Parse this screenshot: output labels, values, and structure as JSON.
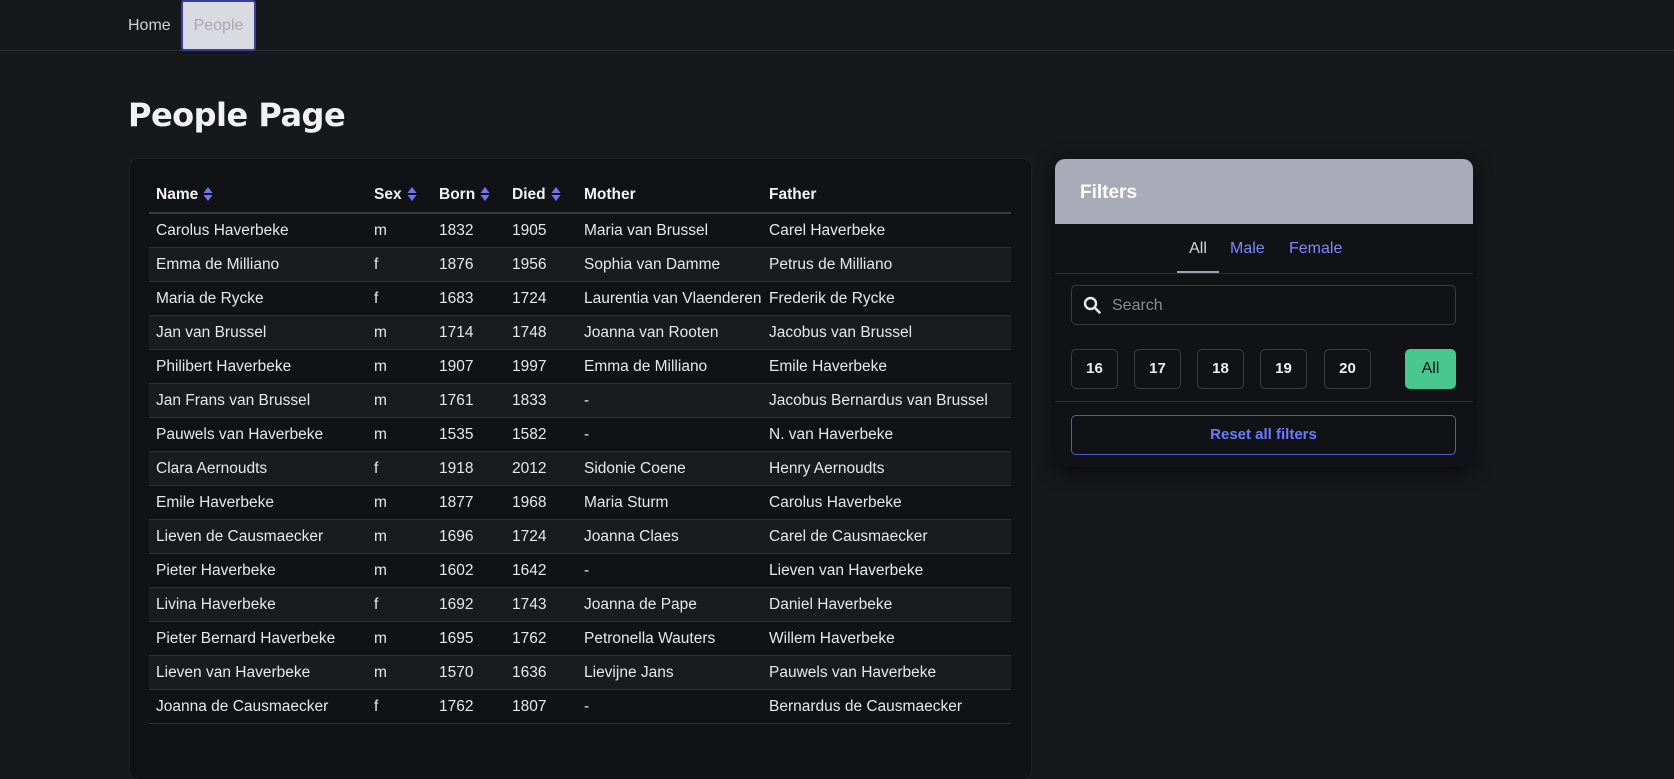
{
  "nav": {
    "home_label": "Home",
    "people_label": "People"
  },
  "page": {
    "title": "People Page"
  },
  "table": {
    "headers": {
      "name": "Name",
      "sex": "Sex",
      "born": "Born",
      "died": "Died",
      "mother": "Mother",
      "father": "Father"
    },
    "rows": [
      {
        "name": "Carolus Haverbeke",
        "name_sex": "m",
        "sex": "m",
        "born": "1832",
        "died": "1905",
        "mother": "Maria van Brussel",
        "mother_link": true,
        "father": "Carel Haverbeke",
        "father_link": true
      },
      {
        "name": "Emma de Milliano",
        "name_sex": "f",
        "sex": "f",
        "born": "1876",
        "died": "1956",
        "mother": "Sophia van Damme",
        "mother_link": false,
        "father": "Petrus de Milliano",
        "father_link": false
      },
      {
        "name": "Maria de Rycke",
        "name_sex": "f",
        "sex": "f",
        "born": "1683",
        "died": "1724",
        "mother": "Laurentia van Vlaenderen",
        "mother_link": false,
        "father": "Frederik de Rycke",
        "father_link": false
      },
      {
        "name": "Jan van Brussel",
        "name_sex": "m",
        "sex": "m",
        "born": "1714",
        "died": "1748",
        "mother": "Joanna van Rooten",
        "mother_link": false,
        "father": "Jacobus van Brussel",
        "father_link": false
      },
      {
        "name": "Philibert Haverbeke",
        "name_sex": "m",
        "sex": "m",
        "born": "1907",
        "died": "1997",
        "mother": "Emma de Milliano",
        "mother_link": true,
        "father": "Emile Haverbeke",
        "father_link": true
      },
      {
        "name": "Jan Frans van Brussel",
        "name_sex": "m",
        "sex": "m",
        "born": "1761",
        "died": "1833",
        "mother": "-",
        "mother_link": false,
        "father": "Jacobus Bernardus van Brussel",
        "father_link": true
      },
      {
        "name": "Pauwels van Haverbeke",
        "name_sex": "m",
        "sex": "m",
        "born": "1535",
        "died": "1582",
        "mother": "-",
        "mother_link": false,
        "father": "N. van Haverbeke",
        "father_link": false
      },
      {
        "name": "Clara Aernoudts",
        "name_sex": "f",
        "sex": "f",
        "born": "1918",
        "died": "2012",
        "mother": "Sidonie Coene",
        "mother_link": false,
        "father": "Henry Aernoudts",
        "father_link": false
      },
      {
        "name": "Emile Haverbeke",
        "name_sex": "m",
        "sex": "m",
        "born": "1877",
        "died": "1968",
        "mother": "Maria Sturm",
        "mother_link": true,
        "father": "Carolus Haverbeke",
        "father_link": true
      },
      {
        "name": "Lieven de Causmaecker",
        "name_sex": "m",
        "sex": "m",
        "born": "1696",
        "died": "1724",
        "mother": "Joanna Claes",
        "mother_link": false,
        "father": "Carel de Causmaecker",
        "father_link": false
      },
      {
        "name": "Pieter Haverbeke",
        "name_sex": "m",
        "sex": "m",
        "born": "1602",
        "died": "1642",
        "mother": "-",
        "mother_link": false,
        "father": "Lieven van Haverbeke",
        "father_link": true
      },
      {
        "name": "Livina Haverbeke",
        "name_sex": "f",
        "sex": "f",
        "born": "1692",
        "died": "1743",
        "mother": "Joanna de Pape",
        "mother_link": true,
        "father": "Daniel Haverbeke",
        "father_link": true
      },
      {
        "name": "Pieter Bernard Haverbeke",
        "name_sex": "m",
        "sex": "m",
        "born": "1695",
        "died": "1762",
        "mother": "Petronella Wauters",
        "mother_link": false,
        "father": "Willem Haverbeke",
        "father_link": true
      },
      {
        "name": "Lieven van Haverbeke",
        "name_sex": "m",
        "sex": "m",
        "born": "1570",
        "died": "1636",
        "mother": "Lievijne Jans",
        "mother_link": true,
        "father": "Pauwels van Haverbeke",
        "father_link": true
      },
      {
        "name": "Joanna de Causmaecker",
        "name_sex": "f",
        "sex": "f",
        "born": "1762",
        "died": "1807",
        "mother": "-",
        "mother_link": false,
        "father": "Bernardus de Causmaecker",
        "father_link": true
      }
    ]
  },
  "filters": {
    "title": "Filters",
    "tabs": {
      "all": "All",
      "male": "Male",
      "female": "Female"
    },
    "search_placeholder": "Search",
    "centuries": [
      "16",
      "17",
      "18",
      "19",
      "20"
    ],
    "century_all": "All",
    "reset_label": "Reset all filters"
  },
  "colors": {
    "male_link": "#7b87ff",
    "female_link": "#ff5c7a",
    "accent_green": "#48c78e",
    "accent_blue": "#485fc7"
  }
}
